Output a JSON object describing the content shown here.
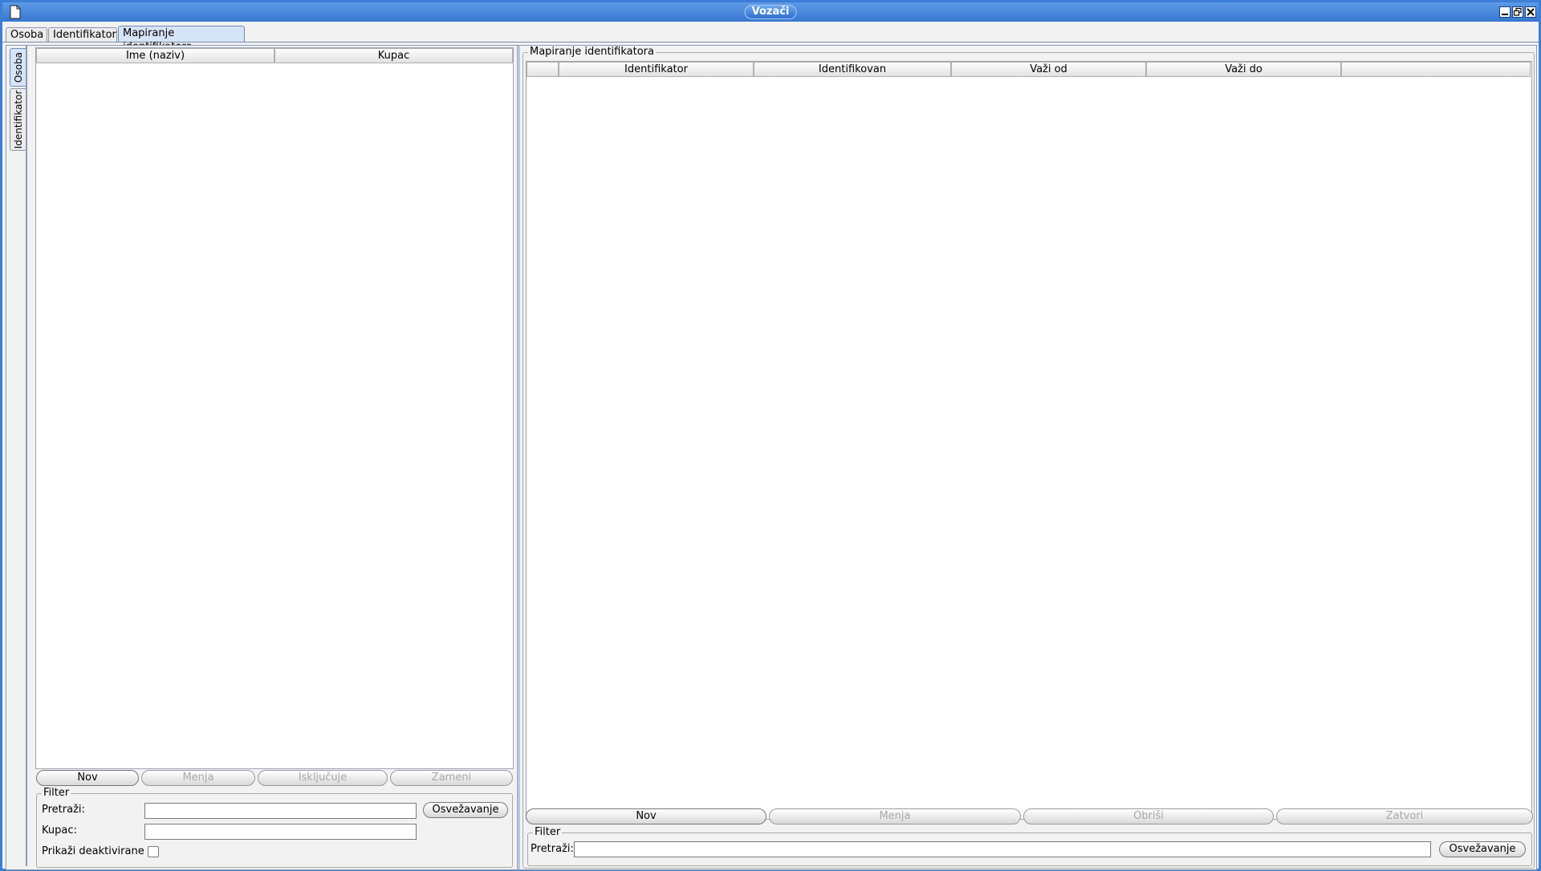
{
  "window": {
    "title": "Vozači"
  },
  "top_tabs": [
    {
      "label": "Osoba"
    },
    {
      "label": "Identifikator"
    },
    {
      "label": "Mapiranje identifikatora",
      "active": true
    }
  ],
  "side_tabs": [
    {
      "label": "Osoba",
      "active": true
    },
    {
      "label": "Identifikator"
    }
  ],
  "left_panel": {
    "table": {
      "columns": [
        "Ime (naziv)",
        "Kupac"
      ],
      "rows": []
    },
    "buttons": {
      "new": "Nov",
      "edit": "Menja",
      "disable": "Isključuje",
      "replace": "Zameni"
    },
    "filter": {
      "legend": "Filter",
      "search_label": "Pretraži:",
      "search_value": "",
      "customer_label": "Kupac:",
      "customer_value": "",
      "show_deactivated_label": "Prikaži deaktivirane",
      "show_deactivated": false,
      "refresh_label": "Osvežavanje"
    }
  },
  "right_panel": {
    "legend": "Mapiranje identifikatora",
    "table": {
      "columns": [
        "",
        "Identifikator",
        "Identifikovan",
        "Važi od",
        "Važi do",
        ""
      ],
      "rows": []
    },
    "buttons": {
      "new": "Nov",
      "edit": "Menja",
      "delete": "Obriši",
      "close": "Zatvori"
    },
    "filter": {
      "legend": "Filter",
      "search_label": "Pretraži:",
      "search_value": "",
      "refresh_label": "Osvežavanje"
    }
  }
}
